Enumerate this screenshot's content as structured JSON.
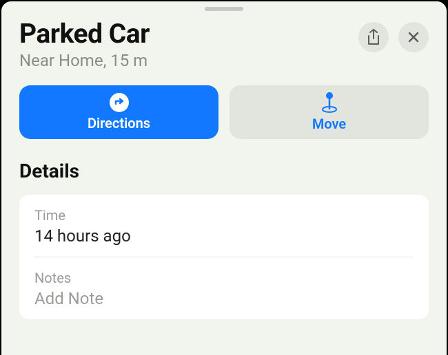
{
  "header": {
    "title": "Parked Car",
    "subtitle": "Near Home, 15 m"
  },
  "actions": {
    "directions": "Directions",
    "move": "Move"
  },
  "details": {
    "section_title": "Details",
    "time_label": "Time",
    "time_value": "14 hours ago",
    "notes_label": "Notes",
    "notes_placeholder": "Add Note"
  }
}
